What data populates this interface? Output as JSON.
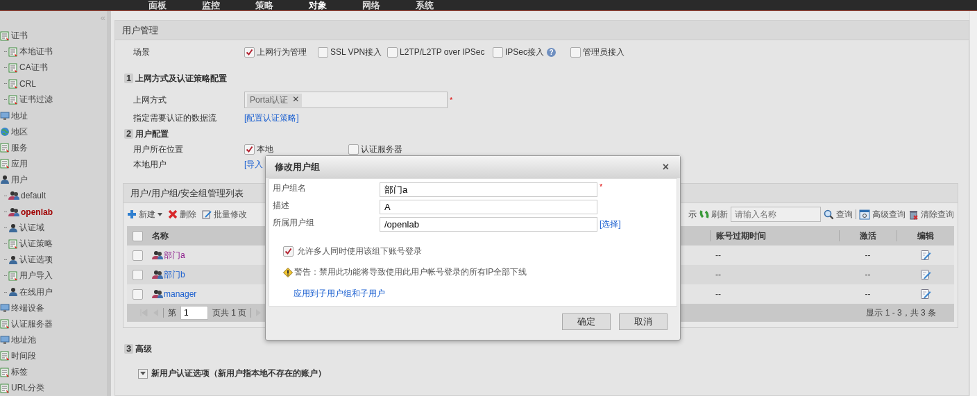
{
  "top_nav": {
    "items": [
      {
        "label": "面板",
        "selected": false
      },
      {
        "label": "监控",
        "selected": false
      },
      {
        "label": "策略",
        "selected": false
      },
      {
        "label": "对象",
        "selected": true
      },
      {
        "label": "网络",
        "selected": false
      },
      {
        "label": "系统",
        "selected": false
      }
    ]
  },
  "sidebar": {
    "collapse": "«",
    "items": [
      {
        "label": "证书",
        "kind": "doc",
        "selected": false,
        "children": [
          {
            "label": "本地证书",
            "kind": "doc",
            "selected": false
          },
          {
            "label": "CA证书",
            "kind": "doc",
            "selected": false
          },
          {
            "label": "CRL",
            "kind": "doc",
            "selected": false
          },
          {
            "label": "证书过滤",
            "kind": "doc",
            "selected": false
          }
        ]
      },
      {
        "label": "地址",
        "kind": "monitor",
        "selected": false
      },
      {
        "label": "地区",
        "kind": "globe",
        "selected": false
      },
      {
        "label": "服务",
        "kind": "doc",
        "selected": false
      },
      {
        "label": "应用",
        "kind": "doc",
        "selected": false
      },
      {
        "label": "用户",
        "kind": "person",
        "selected": false,
        "children": [
          {
            "label": "default",
            "kind": "group",
            "selected": false
          },
          {
            "label": "openlab",
            "kind": "group",
            "selected": true
          },
          {
            "label": "认证域",
            "kind": "person",
            "selected": false
          },
          {
            "label": "认证策略",
            "kind": "doc",
            "selected": false
          },
          {
            "label": "认证选项",
            "kind": "person",
            "selected": false
          },
          {
            "label": "用户导入",
            "kind": "doc",
            "selected": false
          },
          {
            "label": "在线用户",
            "kind": "person",
            "selected": false
          }
        ]
      },
      {
        "label": "终端设备",
        "kind": "monitor",
        "selected": false
      },
      {
        "label": "认证服务器",
        "kind": "doc",
        "selected": false
      },
      {
        "label": "地址池",
        "kind": "monitor",
        "selected": false
      },
      {
        "label": "时间段",
        "kind": "doc",
        "selected": false
      },
      {
        "label": "标签",
        "kind": "doc",
        "selected": false
      },
      {
        "label": "URL分类",
        "kind": "doc",
        "selected": false
      }
    ]
  },
  "panel": {
    "title": "用户管理",
    "scene": {
      "label": "场景",
      "options": [
        {
          "label": "上网行为管理",
          "checked": true
        },
        {
          "label": "SSL VPN接入",
          "checked": false
        },
        {
          "label": "L2TP/L2TP over IPSec",
          "checked": false
        },
        {
          "label": "IPSec接入",
          "checked": false,
          "help": "?"
        },
        {
          "label": "管理员接入",
          "checked": false
        }
      ]
    },
    "access_section": {
      "number": "1",
      "title": "上网方式及认证策略配置",
      "access_mode": {
        "label": "上网方式",
        "tags": [
          {
            "text": "Portal认证",
            "remove": "✕"
          }
        ],
        "required_mark": "*"
      },
      "flow": {
        "label": "指定需要认证的数据流",
        "link": "[配置认证策略]"
      }
    },
    "user_section": {
      "number": "2",
      "title": "用户配置",
      "location": {
        "label": "用户所在位置",
        "options": [
          {
            "label": "本地",
            "checked": true
          },
          {
            "label": "认证服务器",
            "checked": false
          }
        ]
      },
      "local_users": {
        "label": "本地用户",
        "link": "[导入"
      }
    },
    "list": {
      "title": "用户/用户组/安全组管理列表",
      "toolbar_left": [
        {
          "kind": "new",
          "label": "新建"
        },
        {
          "kind": "delete",
          "label": "删除"
        },
        {
          "kind": "batch",
          "label": "批量修改"
        }
      ],
      "toolbar_right": [
        {
          "kind": "text",
          "label": "示"
        },
        {
          "kind": "refresh",
          "label": "刷新"
        },
        {
          "kind": "search_field",
          "placeholder": "请输入名称"
        },
        {
          "kind": "query",
          "label": "查询"
        },
        {
          "kind": "advanced",
          "label": "高级查询"
        },
        {
          "kind": "clear",
          "label": "清除查询"
        }
      ],
      "select_all": {
        "checked": false
      },
      "columns": [
        {
          "label": "名称"
        },
        {
          "label": "账号过期时间"
        },
        {
          "label": "激活"
        },
        {
          "label": "编辑"
        }
      ],
      "rows": [
        {
          "name": "部门a",
          "visited": true,
          "checked": false,
          "expiry": "--",
          "active": "--"
        },
        {
          "name": "部门b",
          "visited": false,
          "checked": false,
          "expiry": "--",
          "active": "--"
        },
        {
          "name": "manager",
          "visited": false,
          "checked": false,
          "expiry": "--",
          "active": "--"
        }
      ],
      "pager": {
        "page_label": "第",
        "page": "1",
        "total": "页共 1 页",
        "summary": "显示 1 - 3，共 3 条"
      }
    },
    "advanced_section": {
      "number": "3",
      "title": "高级",
      "option": {
        "label": "新用户认证选项（新用户指本地不存在的账户）",
        "expanded": false
      }
    }
  },
  "dialog": {
    "title": "修改用户组",
    "close": "×",
    "fields": [
      {
        "label": "用户组名",
        "value": "部门a",
        "required_mark": "*"
      },
      {
        "label": "描述",
        "value": "A"
      },
      {
        "label": "所属用户组",
        "value": "/openlab",
        "link": "[选择]"
      }
    ],
    "allow_multi": {
      "label": "允许多人同时使用该组下账号登录",
      "checked": true
    },
    "warning": "警告：禁用此功能将导致使用此用户帐号登录的所有IP全部下线",
    "apply_link": "应用到子用户组和子用户",
    "buttons": [
      {
        "label": "确定"
      },
      {
        "label": "取消"
      }
    ]
  }
}
